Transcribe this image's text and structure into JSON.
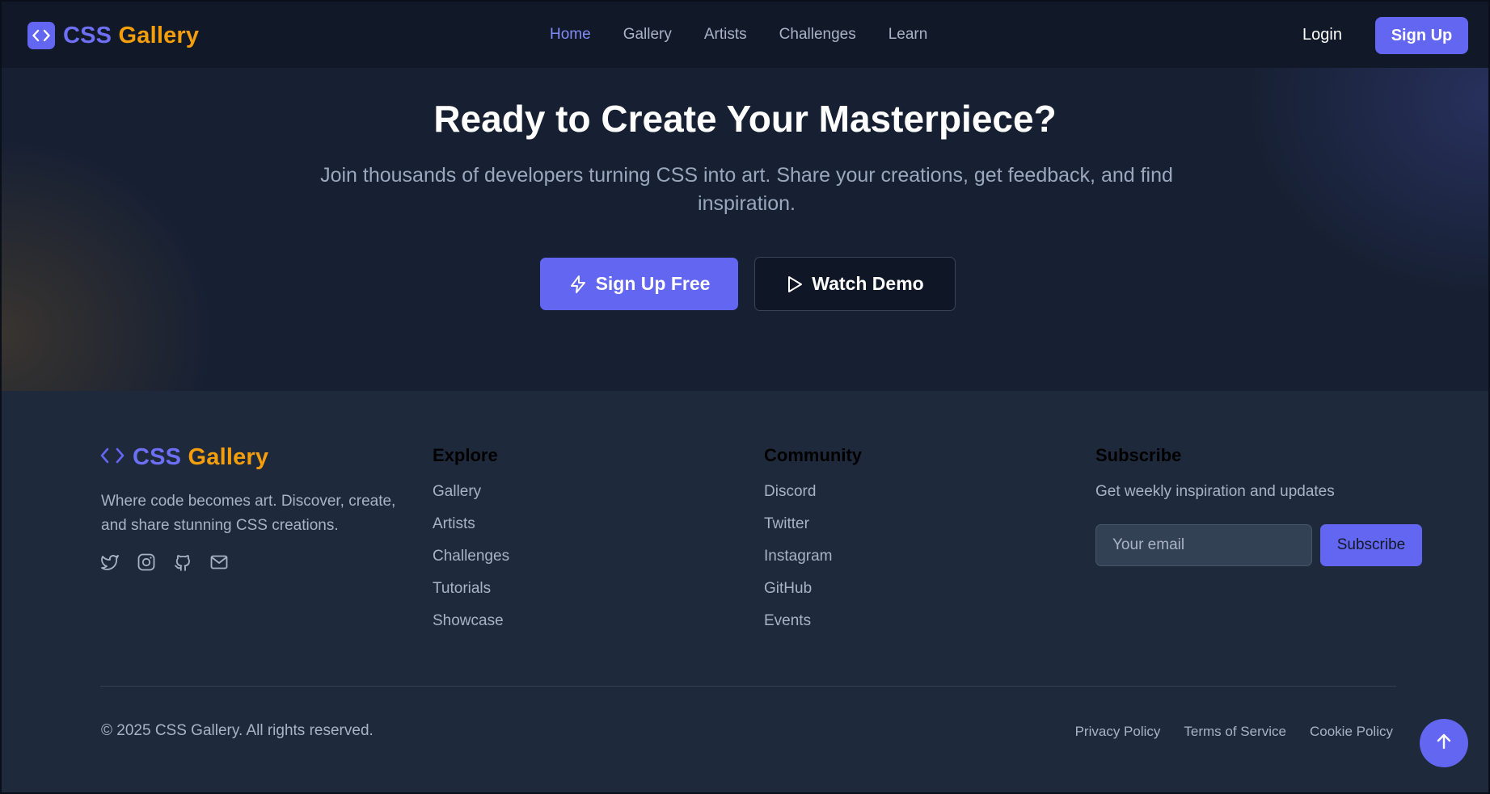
{
  "nav": {
    "brand_css": "CSS",
    "brand_gallery": "Gallery",
    "links": [
      "Home",
      "Gallery",
      "Artists",
      "Challenges",
      "Learn"
    ],
    "active_link": "Home",
    "login": "Login",
    "signup": "Sign Up"
  },
  "hero": {
    "title": "Ready to Create Your Masterpiece?",
    "subtitle": "Join thousands of developers turning CSS into art. Share your creations, get feedback, and find inspiration.",
    "primary_button": "Sign Up Free",
    "primary_icon": "lightning-icon",
    "secondary_button": "Watch Demo",
    "secondary_icon": "play-icon"
  },
  "footer": {
    "brand_css": "CSS",
    "brand_gallery": "Gallery",
    "description": "Where code becomes art. Discover, create, and share stunning CSS creations.",
    "socials": [
      "twitter-icon",
      "instagram-icon",
      "github-icon",
      "mail-icon"
    ],
    "explore": {
      "heading": "Explore",
      "links": [
        "Gallery",
        "Artists",
        "Challenges",
        "Tutorials",
        "Showcase"
      ]
    },
    "community": {
      "heading": "Community",
      "links": [
        "Discord",
        "Twitter",
        "Instagram",
        "GitHub",
        "Events"
      ]
    },
    "subscribe": {
      "heading": "Subscribe",
      "text": "Get weekly inspiration and updates",
      "email_placeholder": "Your email",
      "button": "Subscribe"
    },
    "copyright": "© 2025 CSS Gallery. All rights reserved.",
    "legal": [
      "Privacy Policy",
      "Terms of Service",
      "Cookie Policy"
    ],
    "scroll_top_icon": "arrow-up-icon"
  },
  "colors": {
    "accent": "#6366f1",
    "brand_orange": "#f59e0b",
    "nav_bg": "#111827",
    "footer_bg": "#1e293b"
  }
}
